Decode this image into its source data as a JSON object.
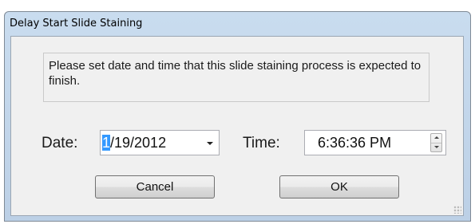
{
  "window": {
    "title": "Delay Start Slide Staining"
  },
  "message": "Please set date and time that this slide staining process is expected to finish.",
  "date": {
    "label": "Date:",
    "selected_part": "1",
    "rest": "/19/2012"
  },
  "time": {
    "label": "Time:",
    "value": "6:36:36 PM"
  },
  "buttons": {
    "cancel": "Cancel",
    "ok": "OK"
  },
  "colors": {
    "selection": "#3399ff",
    "frame": "#c9dcef"
  }
}
